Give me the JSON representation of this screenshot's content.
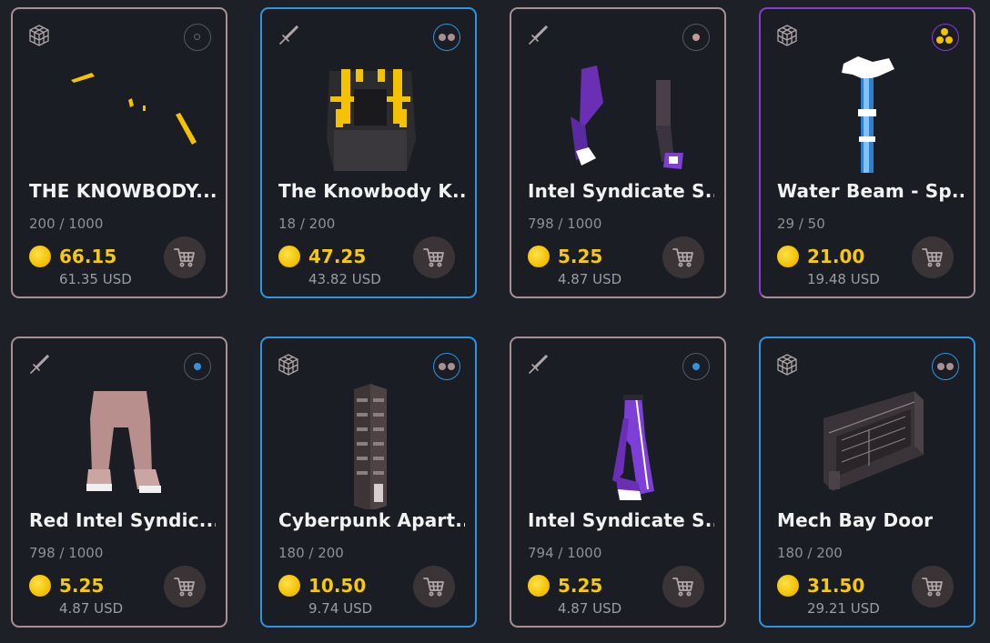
{
  "cards": [
    {
      "name": "THE KNOWBODY...",
      "supply": "200 / 1000",
      "price": "66.15",
      "usd": "61.35 USD",
      "category": "cube-icon",
      "rarity": "empty",
      "art": "yellow-shards"
    },
    {
      "name": "The Knowbody K...",
      "supply": "18 / 200",
      "price": "47.25",
      "usd": "43.82 USD",
      "category": "sword-icon",
      "rarity": "two-dots",
      "art": "striped-helmet"
    },
    {
      "name": "Intel Syndicate S...",
      "supply": "798 / 1000",
      "price": "5.25",
      "usd": "4.87 USD",
      "category": "sword-icon",
      "rarity": "one-dot-pink",
      "art": "purple-legs"
    },
    {
      "name": "Water Beam - Sp...",
      "supply": "29 / 50",
      "price": "21.00",
      "usd": "19.48 USD",
      "category": "cube-icon",
      "rarity": "three-dots",
      "art": "water-beam"
    },
    {
      "name": "Red Intel Syndic...",
      "supply": "798 / 1000",
      "price": "5.25",
      "usd": "4.87 USD",
      "category": "sword-icon",
      "rarity": "one-dot-blue",
      "art": "pink-pants"
    },
    {
      "name": "Cyberpunk Apart...",
      "supply": "180 / 200",
      "price": "10.50",
      "usd": "9.74 USD",
      "category": "cube-icon",
      "rarity": "two-dots",
      "art": "tower"
    },
    {
      "name": "Intel Syndicate S...",
      "supply": "794 / 1000",
      "price": "5.25",
      "usd": "4.87 USD",
      "category": "sword-icon",
      "rarity": "one-dot-blue",
      "art": "purple-boots"
    },
    {
      "name": "Mech Bay Door",
      "supply": "180 / 200",
      "price": "31.50",
      "usd": "29.21 USD",
      "category": "cube-icon",
      "rarity": "two-dots",
      "art": "bay-door"
    }
  ],
  "icons": {
    "cart": "shopping-cart-icon",
    "coin": "coin-icon"
  },
  "colors": {
    "price": "#f6c90e",
    "border_default": "#a89092",
    "border_blue": "#2f95e0",
    "border_purple": "#8a3bd6",
    "background": "#1d2026"
  }
}
